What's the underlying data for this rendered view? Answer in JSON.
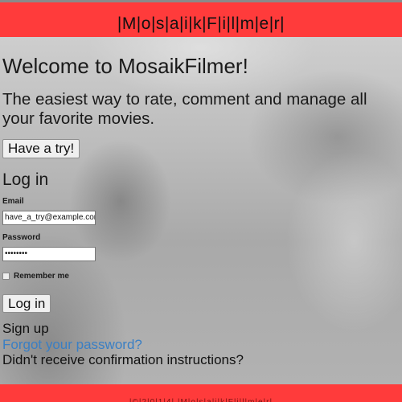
{
  "header": {
    "brand": "|M|o|s|a|i|k|F|i|l|m|e|r|"
  },
  "hero": {
    "title": "Welcome to MosaikFilmer!",
    "tagline_line1": "The easiest way to rate, comment and manage all",
    "tagline_line2": "your favorite movies.",
    "try_button": "Have a try!"
  },
  "login": {
    "title": "Log in",
    "email_label": "Email",
    "email_value": "have_a_try@example.com",
    "password_label": "Password",
    "password_value": "••••••••",
    "remember_label": "Remember me",
    "submit_label": "Log in"
  },
  "links": {
    "sign_up": "Sign up",
    "forgot_password": "Forgot your password?",
    "confirmation": "Didn't receive confirmation instructions?"
  },
  "footer": {
    "text": "|©|2|0|1|4| |M|o|s|a|i|k|F|i|l|m|e|r|"
  },
  "colors": {
    "bar_red": "#ff3b3b",
    "link_blue": "#3a7fc4"
  }
}
